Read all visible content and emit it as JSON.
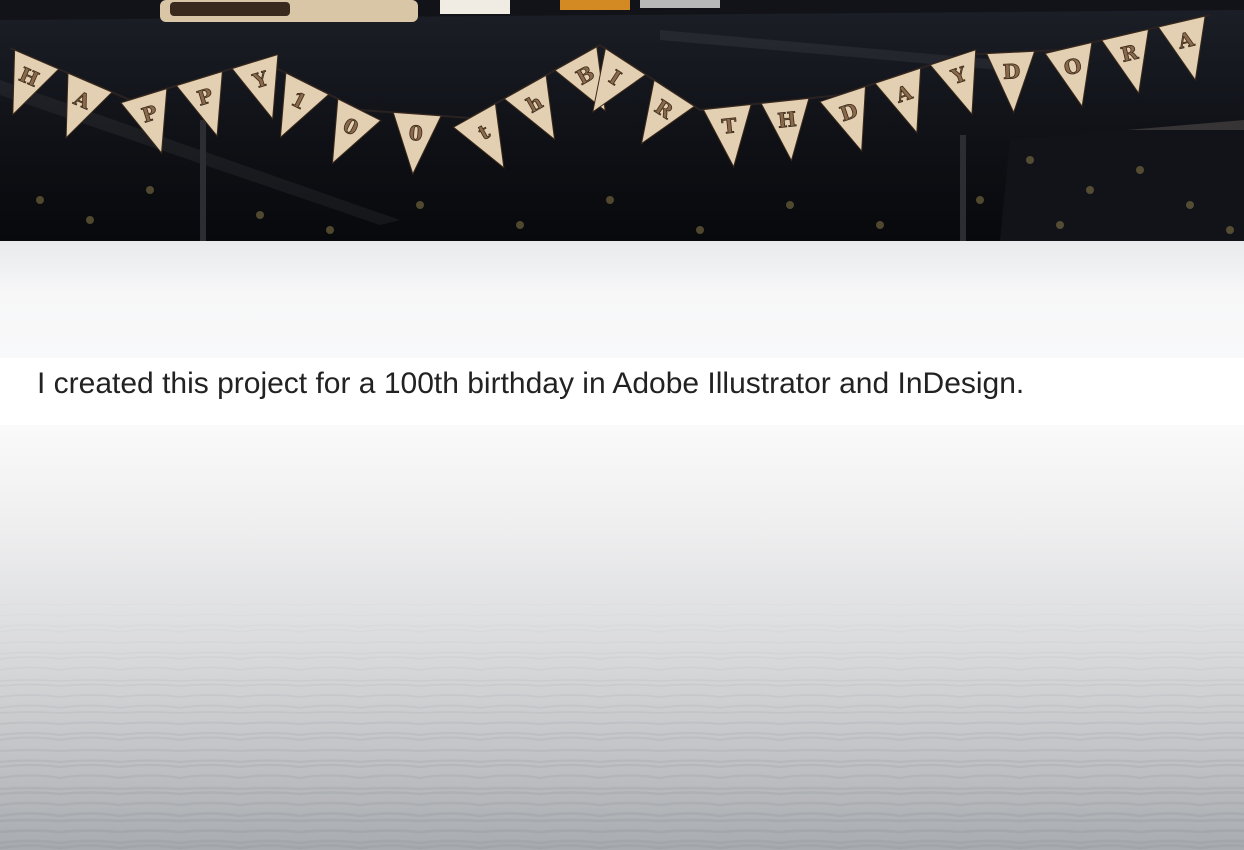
{
  "project": {
    "description": "I created this project for a 100th birthday in Adobe Illustrator and InDesign.",
    "banner_letters": [
      "H",
      "A",
      "P",
      "P",
      "Y",
      "1",
      "0",
      "0",
      "t",
      "h",
      "B",
      "I",
      "R",
      "T",
      "H",
      "D",
      "A",
      "Y",
      "D",
      "O",
      "R",
      "A"
    ]
  },
  "colors": {
    "tablecloth": "#0c0d10",
    "pennant": "#e3cfb2",
    "caption_bg": "#ffffff",
    "caption_text": "#222222"
  }
}
